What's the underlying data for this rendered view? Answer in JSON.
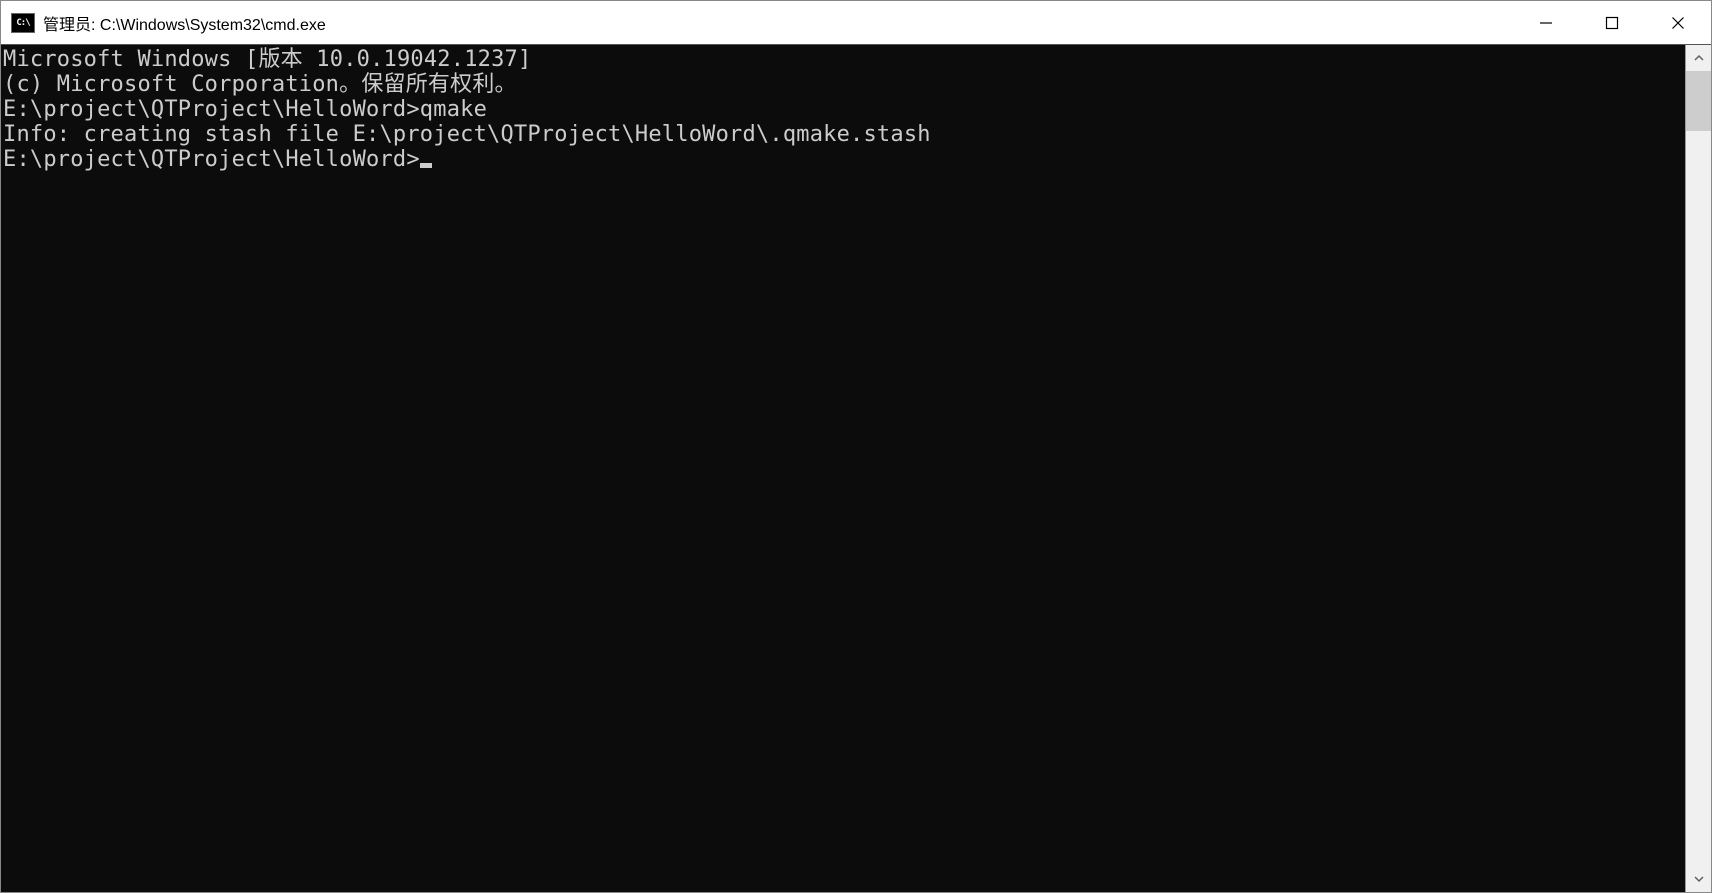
{
  "window": {
    "icon_text": "C:\\",
    "title": "管理员: C:\\Windows\\System32\\cmd.exe"
  },
  "terminal": {
    "lines": [
      "Microsoft Windows [版本 10.0.19042.1237]",
      "(c) Microsoft Corporation。保留所有权利。",
      "",
      "E:\\project\\QTProject\\HelloWord>qmake",
      "Info: creating stash file E:\\project\\QTProject\\HelloWord\\.qmake.stash",
      "",
      "E:\\project\\QTProject\\HelloWord>"
    ]
  }
}
